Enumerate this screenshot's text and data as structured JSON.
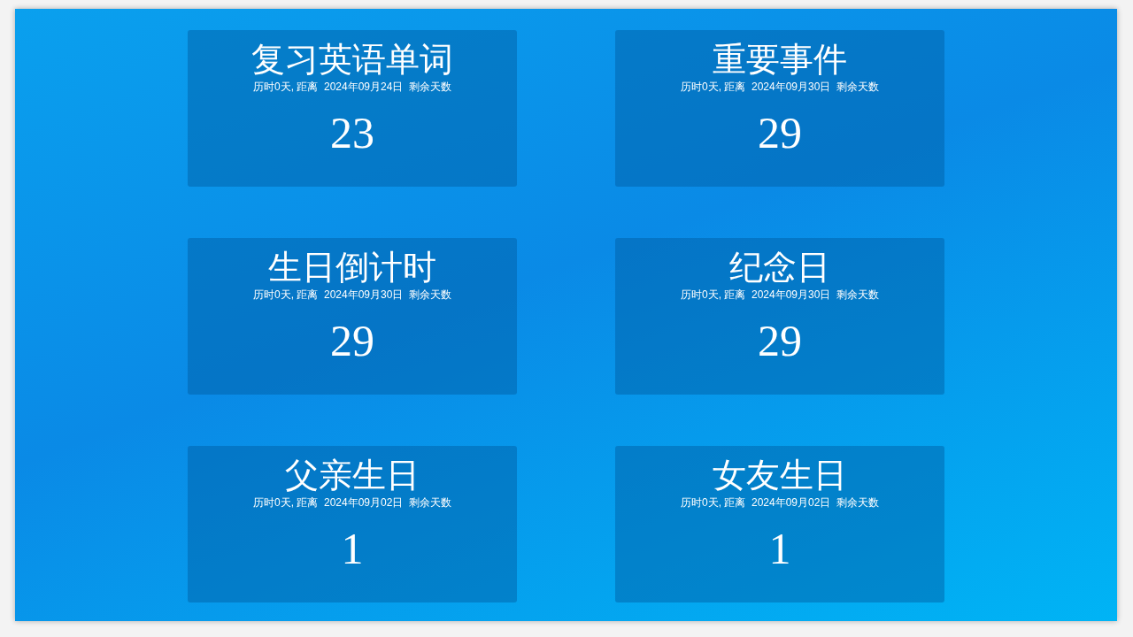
{
  "cards": [
    {
      "title": "复习英语单词",
      "subtitle": "历时0天, 距离  2024年09月24日  剩余天数",
      "days": "23"
    },
    {
      "title": "重要事件",
      "subtitle": "历时0天, 距离  2024年09月30日  剩余天数",
      "days": "29"
    },
    {
      "title": "生日倒计时",
      "subtitle": "历时0天, 距离  2024年09月30日  剩余天数",
      "days": "29"
    },
    {
      "title": "纪念日",
      "subtitle": "历时0天, 距离  2024年09月30日  剩余天数",
      "days": "29"
    },
    {
      "title": "父亲生日",
      "subtitle": "历时0天, 距离  2024年09月02日  剩余天数",
      "days": "1"
    },
    {
      "title": "女友生日",
      "subtitle": "历时0天, 距离  2024年09月02日  剩余天数",
      "days": "1"
    }
  ]
}
